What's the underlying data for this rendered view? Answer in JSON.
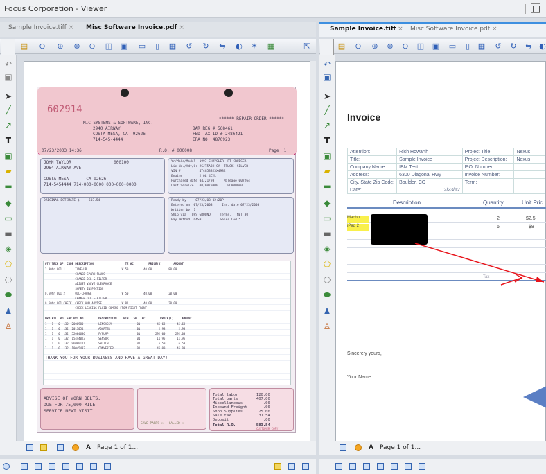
{
  "app": {
    "title": "Focus Corporation - Viewer"
  },
  "left_pane": {
    "tabs": [
      {
        "label": "Sample Invoice.tiff",
        "close": "×"
      },
      {
        "label": "Misc Software Invoice.pdf",
        "close": "×"
      }
    ],
    "page_label": "Page 1 of 1..."
  },
  "right_pane": {
    "tabs": [
      {
        "label": "Sample Invoice.tiff",
        "close": "×"
      },
      {
        "label": "Misc Software Invoice.pdf",
        "close": "×"
      }
    ],
    "page_label": "Page 1 of 1..."
  },
  "receipt": {
    "number": "602914",
    "repair_order": "****** REPAIR ORDER ******",
    "company": [
      "MIC SYSTEMS & SOFTWARE, INC.",
      "2940 AIRWAY",
      "COSTA MESA, CA  92626",
      "714-545-4444"
    ],
    "bar_reg": "BAR REG # 568461",
    "fed_tax": "FED TAX ID # 2486421",
    "epa": "EPA NO. 4870923",
    "date_line": "07/23/2003 14:36",
    "ro_line": "R.O. # 000008",
    "page_line": "Page  1",
    "customer": [
      "JOHN TAYLOR                 000100",
      "2964 AIRWAY AVE",
      "",
      "COSTA MESA       CA 92626",
      "714-5454444 714-000-0000 000-000-0000"
    ],
    "vehicle": [
      "Yr/Make/Model  1997 CHRYSLER  PT CRUISER",
      "Lic No./Adv/Cr 2SJT5A3H CA  TRUCK  SILVER",
      "VIN #          4T4G53823X4982",
      "Engine         2.0L 4CYL",
      "Purchased date 04/21/98     Mileage 007264",
      "Last Service   00/00/0000     PC000000"
    ],
    "estimate": "ORIGINAL ESTIMATE $     503.54",
    "ready": [
      "Ready by     07/23/03 02:20P",
      "Entered on  07/23/2003     Inv. date 07/23/2003",
      "Written by  1",
      "Ship via   UPS GROUND     Terms.   NET 30",
      "Pay Method  CASH          Sales Cod 5"
    ],
    "col_header": "QTY TECH OP. CODE DESCRIPTION                   TE AC         PRICE(R)       AMOUNT",
    "labor_lines": [
      "2.00hr 001 1      TUNE-UP                     W 50         40.00          80.00",
      "                  CHANGE SPARK-PLUGS",
      "                  CHANGE OIL & FILTER",
      "                  ADJUST VALVE CLEARANCE",
      "                  SAFETY INSPECTION",
      "0.50hr 001 2      OIL-CHANGE                  W 50         40.00          20.00",
      "                  CHANGE OIL & FILTER",
      "0.50hr 001 CHECK  CHECK AND ADVISE            W 01         40.00          20.00",
      "                  CHECK LEAKING FLUID COMING FROM RIGHT FRONT"
    ],
    "parts_header": "ORD FIL  BO  SHP PRT NO.        DESCRIPTION    BIN   SP   AC         PRICE(L)     AMOUNT",
    "parts_lines": [
      "1   1   0  132  2000980         LENSASSY               01          45.63       45.63",
      "1   1   0  132  2013054         ADAPTER                01           2.98        2.98",
      "1   1   0  132  52004636        F/PUMP                 01         292.00      292.00",
      "1   1   0  132  15444023        SENSOR                 01          11.95       11.95",
      "1   1   0  132  96000111        SWITCH                 01           6.50        6.50",
      "1   1   0  132  10045433        CONVERTER              01          46.00       46.00"
    ],
    "thanks": "THANK YOU FOR YOUR BUSINESS AND HAVE A GREAT DAY!",
    "advise": [
      "ADVISE OF WORN BELTS.",
      "DUE FOR 75,000 MILE",
      "SERVICE NEXT VISIT."
    ],
    "totals": [
      "Total labor        120.00",
      "Total parts        407.00",
      "Miscellaneous         .00",
      "Inbound Freight       .00",
      "Shop Supplies       25.00",
      "Sale tax            31.54",
      "Deposit               .00"
    ],
    "total_ro": "Total R.O.         583.54",
    "save_parts": "SAVE PARTS ☐   CALLED ☐",
    "customer_copy": "CUSTOMER COPY"
  },
  "invoice": {
    "title": "Invoice",
    "rows": [
      [
        "Attention:",
        "Rich Howarth",
        "Project Title:",
        "Nexus"
      ],
      [
        "Title:",
        "Sample Invoice",
        "Project Description:",
        "Nexus"
      ],
      [
        "Company Name:",
        "IBM Test",
        "P.O. Number:",
        ""
      ],
      [
        "Address:",
        "6300 Diagonal Hwy",
        "Invoice Number:",
        ""
      ],
      [
        "City, State Zip Code:",
        "Boulder, CO",
        "Term:",
        ""
      ],
      [
        "Date:",
        "2/23/12",
        "",
        ""
      ]
    ],
    "headers": {
      "description": "Description",
      "quantity": "Quantity",
      "unit_price": "Unit Pric"
    },
    "items": [
      {
        "name": "Macbo",
        "qty": "2",
        "price": "$2,5"
      },
      {
        "name": "iPad 2",
        "qty": "6",
        "price": "$8"
      }
    ],
    "tax_label": "Tax",
    "closing": "Sincerely yours,",
    "signature": "Your Name"
  },
  "colors": {
    "accent": "#3d8fe0",
    "highlight": "#f9f04c",
    "annotation": "#e8151c"
  }
}
